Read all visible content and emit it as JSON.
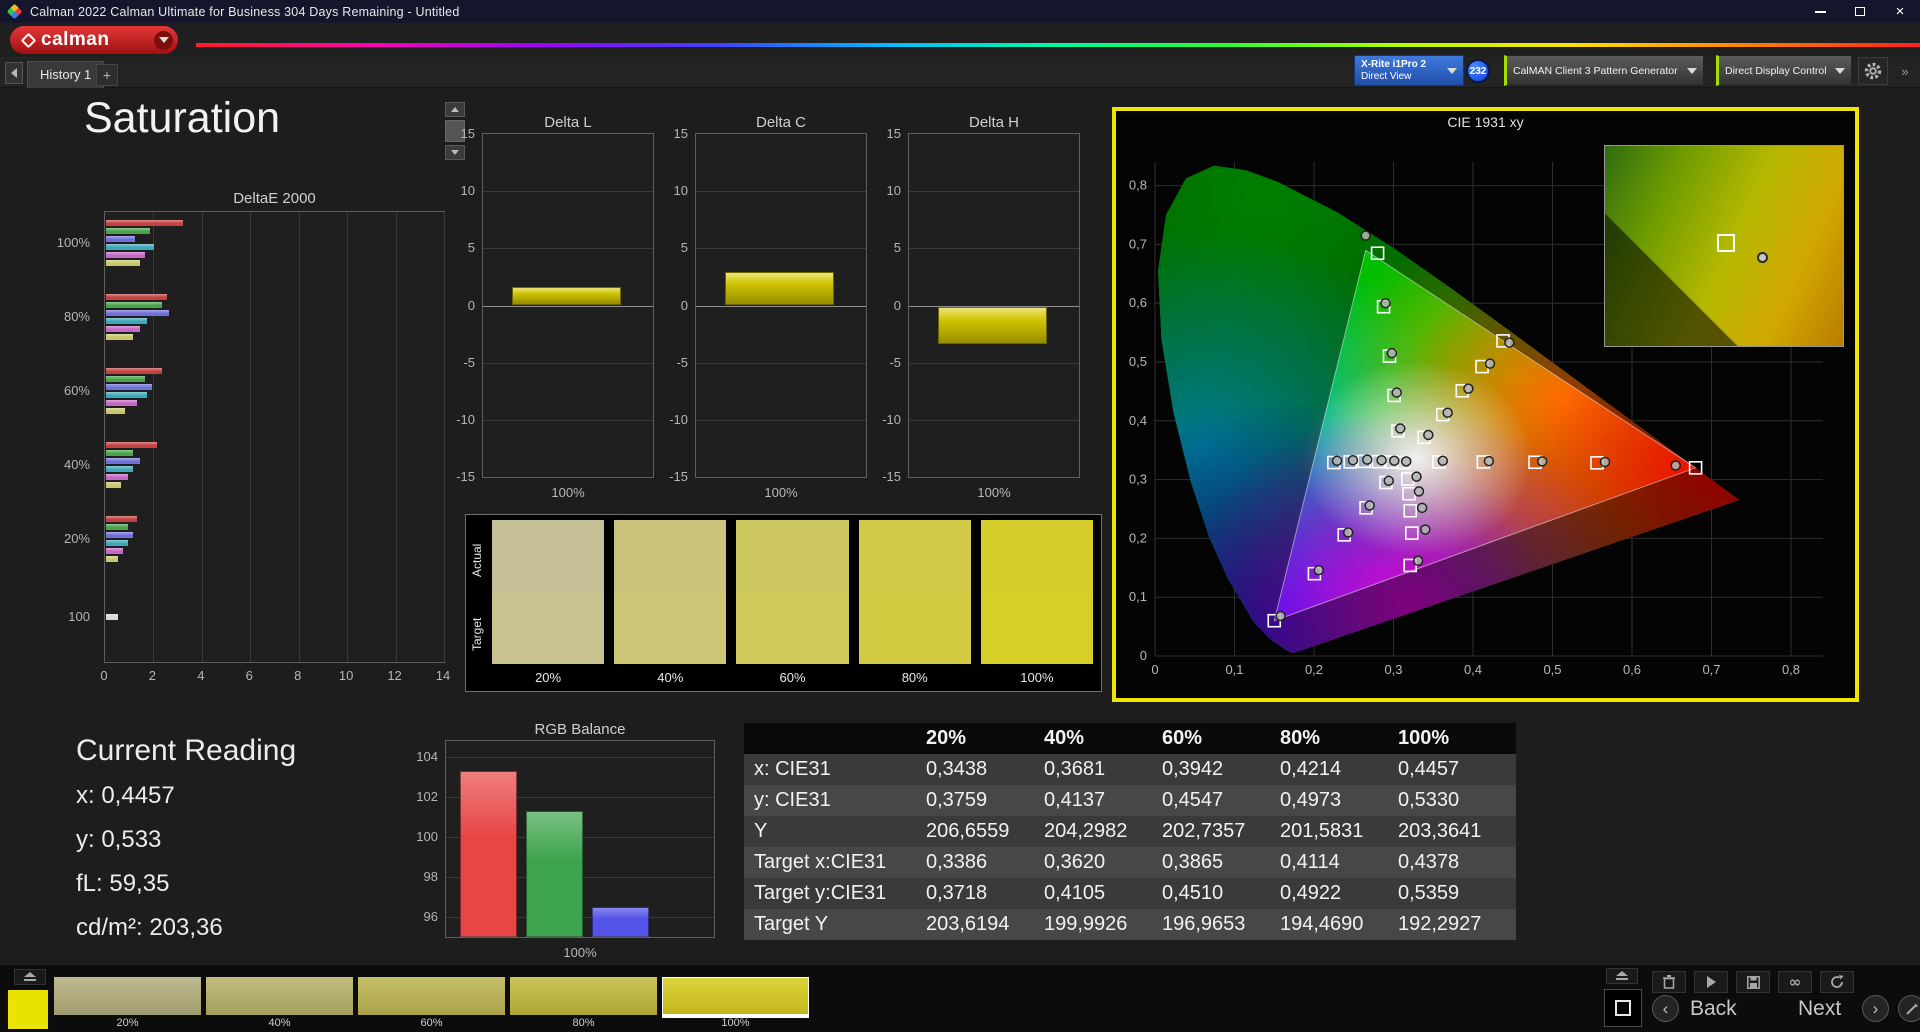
{
  "window": {
    "title": "Calman 2022 Calman Ultimate for Business 304 Days Remaining  - Untitled"
  },
  "toolbar": {
    "logo_text": "calman",
    "meter_dropdown": {
      "line1": "X-Rite i1Pro 2",
      "line2": "Direct View"
    },
    "meter_count_badge": "232",
    "source_dropdown": "CalMAN Client 3 Pattern Generator",
    "display_dropdown": "Direct Display Control"
  },
  "tab_bar": {
    "tab": "History 1",
    "add_tab": "+"
  },
  "page_title": "Saturation",
  "chart_data": {
    "deltae": {
      "type": "bar",
      "title": "DeltaE 2000",
      "orientation": "horizontal",
      "xticks": [
        "0",
        "2",
        "4",
        "6",
        "8",
        "10",
        "12",
        "14"
      ],
      "xmax": 14,
      "palette": [
        "#c44141",
        "#4aa34a",
        "#7070d8",
        "#3fa8b8",
        "#c468c4",
        "#c6c66a"
      ],
      "groups": [
        {
          "label": "100%",
          "values": [
            3.2,
            1.8,
            1.2,
            2.0,
            1.6,
            1.4
          ]
        },
        {
          "label": "80%",
          "values": [
            2.5,
            2.3,
            2.6,
            1.7,
            1.4,
            1.1
          ]
        },
        {
          "label": "60%",
          "values": [
            2.3,
            1.6,
            1.9,
            1.7,
            1.3,
            0.8
          ]
        },
        {
          "label": "40%",
          "values": [
            2.1,
            1.1,
            1.4,
            1.1,
            0.9,
            0.6
          ]
        },
        {
          "label": "20%",
          "values": [
            1.3,
            0.9,
            1.1,
            0.9,
            0.7,
            0.5
          ]
        },
        {
          "label": "100",
          "values": [
            0.5
          ],
          "colors": [
            "#d8d8d8"
          ]
        }
      ]
    },
    "delta_bars": {
      "type": "bar",
      "ymin": -15,
      "ymax": 15,
      "yticks": [
        "15",
        "10",
        "5",
        "0",
        "-5",
        "-10",
        "-15"
      ],
      "xlabel": "100%",
      "bar_color": "#cfc400",
      "charts": [
        {
          "title": "Delta L",
          "value": 1.6
        },
        {
          "title": "Delta C",
          "value": 2.9
        },
        {
          "title": "Delta H",
          "value": -3.3
        }
      ]
    },
    "rgb_balance": {
      "type": "bar",
      "title": "RGB Balance",
      "yticks": [
        "104",
        "102",
        "100",
        "98",
        "96"
      ],
      "ymin": 95,
      "ymax": 104.8,
      "xlabel": "100%",
      "series": [
        {
          "name": "Red",
          "value": 103.3,
          "color": "#e84545"
        },
        {
          "name": "Green",
          "value": 101.3,
          "color": "#3da44d"
        },
        {
          "name": "Blue",
          "value": 96.5,
          "color": "#5353e8"
        }
      ]
    },
    "cie": {
      "type": "scatter",
      "title": "CIE 1931 xy",
      "xticks": [
        "0",
        "0,1",
        "0,2",
        "0,3",
        "0,4",
        "0,5",
        "0,6",
        "0,7",
        "0,8"
      ],
      "yticks": [
        "0",
        "0,1",
        "0,2",
        "0,3",
        "0,4",
        "0,5",
        "0,6",
        "0,7",
        "0,8"
      ],
      "xlim": [
        0,
        0.85
      ],
      "ylim": [
        0,
        0.85
      ],
      "gamut_triangle": [
        [
          0.68,
          0.32
        ],
        [
          0.265,
          0.69
        ],
        [
          0.15,
          0.06
        ]
      ],
      "target_points": [
        [
          0.3386,
          0.3718
        ],
        [
          0.362,
          0.4105
        ],
        [
          0.3865,
          0.451
        ],
        [
          0.4114,
          0.4922
        ],
        [
          0.4378,
          0.5359
        ],
        [
          0.357,
          0.33
        ],
        [
          0.413,
          0.33
        ],
        [
          0.478,
          0.3295
        ],
        [
          0.556,
          0.3285
        ],
        [
          0.68,
          0.32
        ],
        [
          0.3057,
          0.383
        ],
        [
          0.3007,
          0.4431
        ],
        [
          0.295,
          0.51
        ],
        [
          0.2875,
          0.594
        ],
        [
          0.28,
          0.685
        ],
        [
          0.2905,
          0.295
        ],
        [
          0.2655,
          0.252
        ],
        [
          0.238,
          0.206
        ],
        [
          0.2005,
          0.14
        ],
        [
          0.15,
          0.06
        ],
        [
          0.298,
          0.33
        ],
        [
          0.281,
          0.3305
        ],
        [
          0.263,
          0.331
        ],
        [
          0.2455,
          0.33
        ],
        [
          0.225,
          0.329
        ],
        [
          0.318,
          0.301
        ],
        [
          0.3195,
          0.276
        ],
        [
          0.321,
          0.247
        ],
        [
          0.323,
          0.209
        ],
        [
          0.321,
          0.154
        ],
        [
          0.3127,
          0.329
        ]
      ],
      "measured_points": [
        [
          0.3438,
          0.3759
        ],
        [
          0.3681,
          0.4137
        ],
        [
          0.3942,
          0.4547
        ],
        [
          0.4214,
          0.4973
        ],
        [
          0.4457,
          0.533
        ],
        [
          0.362,
          0.332
        ],
        [
          0.42,
          0.3315
        ],
        [
          0.487,
          0.331
        ],
        [
          0.566,
          0.33
        ],
        [
          0.655,
          0.324
        ],
        [
          0.3085,
          0.387
        ],
        [
          0.304,
          0.448
        ],
        [
          0.298,
          0.515
        ],
        [
          0.29,
          0.6
        ],
        [
          0.265,
          0.715
        ],
        [
          0.294,
          0.298
        ],
        [
          0.27,
          0.256
        ],
        [
          0.243,
          0.21
        ],
        [
          0.206,
          0.146
        ],
        [
          0.158,
          0.068
        ],
        [
          0.301,
          0.332
        ],
        [
          0.285,
          0.333
        ],
        [
          0.267,
          0.334
        ],
        [
          0.249,
          0.333
        ],
        [
          0.229,
          0.332
        ],
        [
          0.329,
          0.305
        ],
        [
          0.332,
          0.28
        ],
        [
          0.336,
          0.252
        ],
        [
          0.34,
          0.215
        ],
        [
          0.331,
          0.162
        ],
        [
          0.316,
          0.331
        ]
      ]
    },
    "results_table": {
      "type": "table",
      "columns": [
        "",
        "20%",
        "40%",
        "60%",
        "80%",
        "100%"
      ],
      "rows": [
        {
          "label": "x: CIE31",
          "values": [
            "0,3438",
            "0,3681",
            "0,3942",
            "0,4214",
            "0,4457"
          ]
        },
        {
          "label": "y: CIE31",
          "values": [
            "0,3759",
            "0,4137",
            "0,4547",
            "0,4973",
            "0,5330"
          ]
        },
        {
          "label": "Y",
          "values": [
            "206,6559",
            "204,2982",
            "202,7357",
            "201,5831",
            "203,3641"
          ]
        },
        {
          "label": "Target x:CIE31",
          "values": [
            "0,3386",
            "0,3620",
            "0,3865",
            "0,4114",
            "0,4378"
          ]
        },
        {
          "label": "Target y:CIE31",
          "values": [
            "0,3718",
            "0,4105",
            "0,4510",
            "0,4922",
            "0,5359"
          ]
        },
        {
          "label": "Target Y",
          "values": [
            "203,6194",
            "199,9926",
            "196,9653",
            "194,4690",
            "192,2927"
          ]
        }
      ]
    }
  },
  "swatch_panel": {
    "row_labels": [
      "Actual",
      "Target"
    ],
    "columns": [
      {
        "label": "20%",
        "actual": "#c6c096",
        "target": "#c9c390"
      },
      {
        "label": "40%",
        "actual": "#c9c37b",
        "target": "#cbc675"
      },
      {
        "label": "60%",
        "actual": "#ccc75f",
        "target": "#cec95a"
      },
      {
        "label": "80%",
        "actual": "#d0ca47",
        "target": "#d2cb42"
      },
      {
        "label": "100%",
        "actual": "#d4cd2c",
        "target": "#d6cf28"
      }
    ]
  },
  "current_reading": {
    "title": "Current Reading",
    "lines": [
      "x: 0,4457",
      "y: 0,533",
      "fL: 59,35",
      "cd/m²: 203,36"
    ]
  },
  "bottom_bar": {
    "current_patch_color": "#eae200",
    "swatches": [
      {
        "label": "20%",
        "color": "#b3ae7c",
        "selected": false
      },
      {
        "label": "40%",
        "color": "#b8b167",
        "selected": false
      },
      {
        "label": "60%",
        "color": "#bdb551",
        "selected": false
      },
      {
        "label": "80%",
        "color": "#c2b93a",
        "selected": false
      },
      {
        "label": "100%",
        "color": "#d7cb1c",
        "selected": true
      }
    ],
    "back_label": "Back",
    "next_label": "Next"
  }
}
